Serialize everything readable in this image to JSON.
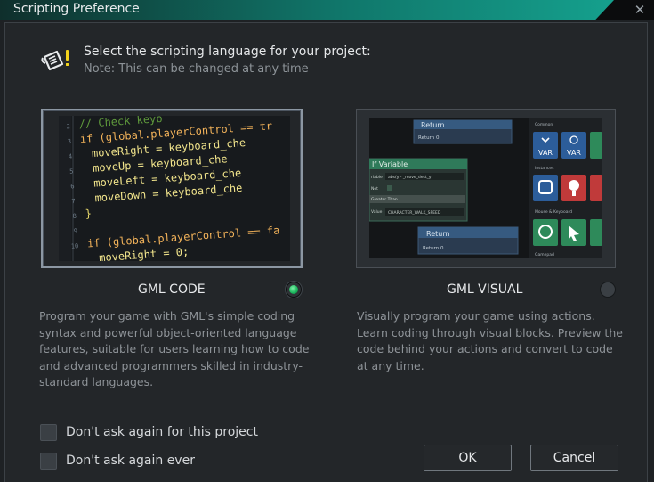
{
  "window": {
    "title": "Scripting Preference",
    "close_glyph": "✕"
  },
  "header": {
    "icon": "script-scroll-icon",
    "prompt": "Select the scripting language for your project:",
    "note": "Note: This can be changed at any time"
  },
  "options": [
    {
      "label": "GML CODE",
      "selected": true,
      "description": "Program your game with GML's simple coding syntax and powerful object-oriented language features, suitable for users learning how to code and advanced programmers skilled in industry-standard languages.",
      "preview": {
        "code_lines": [
          {
            "num": "2",
            "text": "// Check keyb",
            "kind": "comment"
          },
          {
            "num": "3",
            "text": "if (global.playerControl == tr",
            "kind": "if"
          },
          {
            "num": "4",
            "text": "moveRight     = keyboard_che",
            "kind": "assign"
          },
          {
            "num": "5",
            "text": "moveUp        = keyboard_che",
            "kind": "assign"
          },
          {
            "num": "6",
            "text": "moveLeft      = keyboard_che",
            "kind": "assign"
          },
          {
            "num": "7",
            "text": "moveDown      = keyboard_che",
            "kind": "assign"
          },
          {
            "num": "8",
            "text": "}",
            "kind": "brace"
          },
          {
            "num": "9",
            "text": "",
            "kind": "blank"
          },
          {
            "num": "10",
            "text": "if (global.playerControl == fa",
            "kind": "if"
          },
          {
            "num": "",
            "text": "moveRight   = 0;",
            "kind": "assign"
          }
        ]
      }
    },
    {
      "label": "GML VISUAL",
      "selected": false,
      "description": "Visually program your game using actions. Learn coding through visual blocks. Preview the code behind your actions and convert to code at any time.",
      "preview": {
        "blocks": {
          "return_top": {
            "title": "Return",
            "field_label": "Return",
            "field_value": "0"
          },
          "if_variable": {
            "title": "If Variable",
            "rows": [
              {
                "label": "riable",
                "value": "abs(y - _move_dest_y)"
              },
              {
                "label": "Not",
                "value": ""
              },
              {
                "label": "",
                "value": "Greater Than"
              },
              {
                "label": "Value",
                "value": "CHARACTER_WALK_SPEED"
              }
            ]
          },
          "return_bottom": {
            "title": "Return",
            "field_label": "Return",
            "field_value": "0"
          }
        },
        "palette": {
          "sections": [
            "Common",
            "Instances",
            "Mouse & Keyboard",
            "Gamepad"
          ],
          "common_tiles": [
            "VAR",
            "VAR"
          ]
        }
      }
    }
  ],
  "checkboxes": [
    {
      "label": "Don't ask again for this project",
      "checked": false
    },
    {
      "label": "Don't ask again ever",
      "checked": false
    }
  ],
  "buttons": {
    "ok": "OK",
    "cancel": "Cancel"
  },
  "colors": {
    "accent_teal": "#15a08d",
    "selected_radio": "#19b35a",
    "dialog_bg": "#232629"
  }
}
